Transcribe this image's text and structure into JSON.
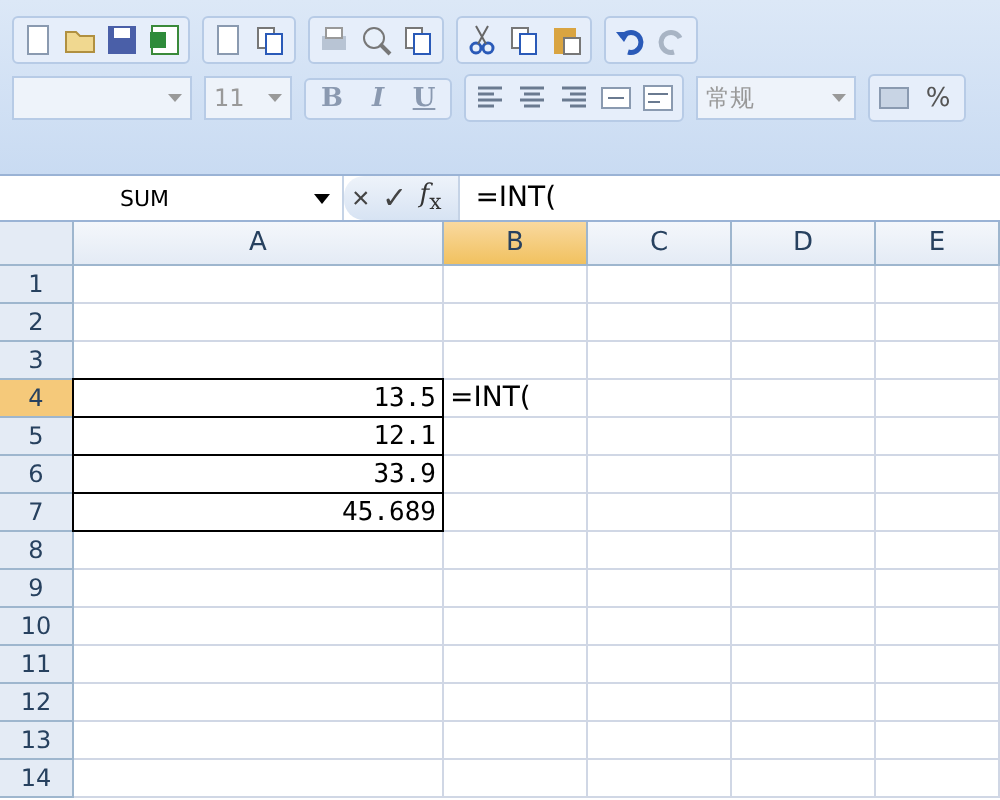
{
  "toolbar": {
    "font_size": "11",
    "bold": "B",
    "italic": "I",
    "underline": "U",
    "number_format": "常规",
    "percent": "%"
  },
  "formula_bar": {
    "name_box": "SUM",
    "cancel": "×",
    "enter": "✓",
    "fx": "*f*$_{x}$",
    "formula": "=INT("
  },
  "sheet": {
    "columns": [
      {
        "label": "A",
        "selected": false
      },
      {
        "label": "B",
        "selected": true
      },
      {
        "label": "C",
        "selected": false
      },
      {
        "label": "D",
        "selected": false
      },
      {
        "label": "E",
        "selected": false
      }
    ],
    "rows": [
      {
        "number": "1",
        "selected": false
      },
      {
        "number": "2",
        "selected": false
      },
      {
        "number": "3",
        "selected": false
      },
      {
        "number": "4",
        "selected": true,
        "cells": [
          {
            "text": "13.5",
            "bordered": true
          },
          {
            "text": "=INT(",
            "active": true
          },
          null,
          null,
          null
        ]
      },
      {
        "number": "5",
        "selected": false,
        "cells": [
          {
            "text": "12.1",
            "bordered": true
          },
          null,
          null,
          null,
          null
        ]
      },
      {
        "number": "6",
        "selected": false,
        "cells": [
          {
            "text": "33.9",
            "bordered": true
          },
          null,
          null,
          null,
          null
        ]
      },
      {
        "number": "7",
        "selected": false,
        "cells": [
          {
            "text": "45.689",
            "bordered": true
          },
          null,
          null,
          null,
          null
        ]
      },
      {
        "number": "8",
        "selected": false
      },
      {
        "number": "9",
        "selected": false
      },
      {
        "number": "10",
        "selected": false
      },
      {
        "number": "11",
        "selected": false
      },
      {
        "number": "12",
        "selected": false
      },
      {
        "number": "13",
        "selected": false
      },
      {
        "number": "14",
        "selected": false
      }
    ]
  }
}
